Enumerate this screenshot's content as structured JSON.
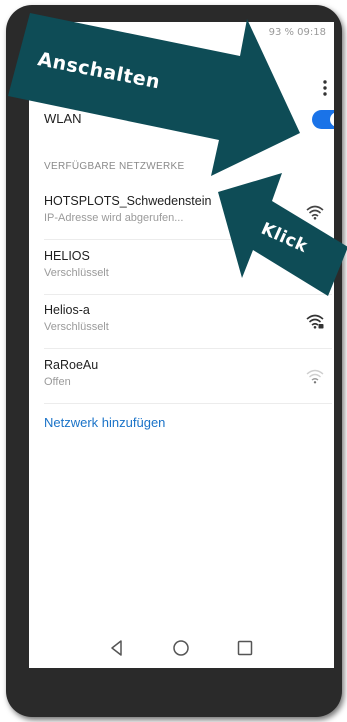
{
  "status_bar": {
    "right_text": "93 %  09:18"
  },
  "wlan": {
    "label": "WLAN",
    "enabled": true
  },
  "section_header": "VERFÜGBARE NETZWERKE",
  "networks": [
    {
      "name": "HOTSPLOTS_Schwedenstein",
      "status": "IP-Adresse wird abgerufen...",
      "signal": "strong-open"
    },
    {
      "name": "HELIOS",
      "status": "Verschlüsselt",
      "signal": "none"
    },
    {
      "name": "Helios-a",
      "status": "Verschlüsselt",
      "signal": "strong-locked"
    },
    {
      "name": "RaRoeAu",
      "status": "Offen",
      "signal": "weak"
    }
  ],
  "add_network_label": "Netzwerk hinzufügen",
  "annotations": {
    "arrow1_label": "Anschalten",
    "arrow2_label": "Klick",
    "arrow_color": "#0e4c56"
  },
  "colors": {
    "accent": "#1a73e8",
    "link": "#1a73c8"
  }
}
